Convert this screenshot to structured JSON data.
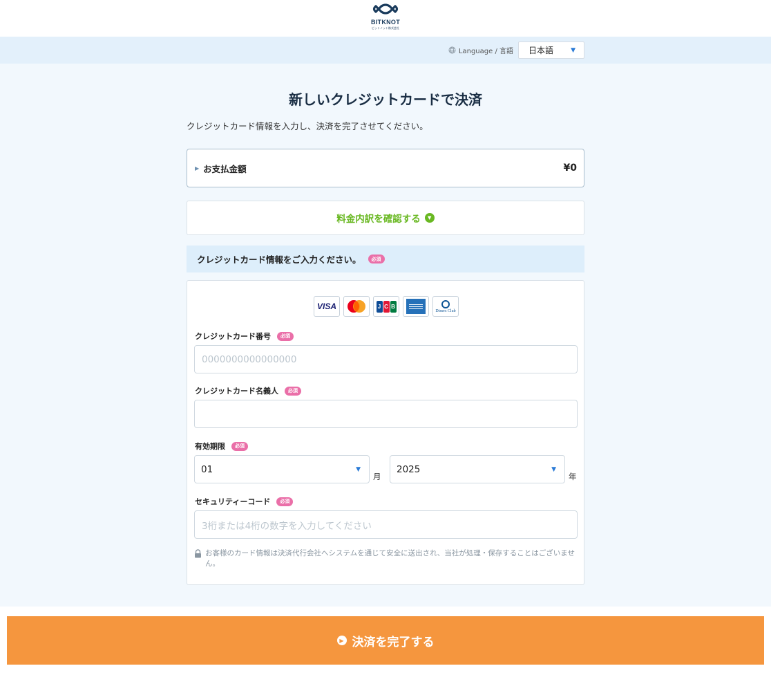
{
  "header": {
    "logo_text": "BITKNOT",
    "logo_subtext": "ビットノット株式会社"
  },
  "langbar": {
    "label": "Language / 言語",
    "selected": "日本語",
    "icon": "globe-icon"
  },
  "page": {
    "title": "新しいクレジットカードで決済",
    "subtitle": "クレジットカード情報を入力し、決済を完了させてください。"
  },
  "amount": {
    "label": "お支払金額",
    "value": "¥0"
  },
  "breakdown": {
    "label": "料金内訳を確認する",
    "icon": "chevron-down-circle-icon"
  },
  "card_section": {
    "title": "クレジットカード情報をご入力ください。",
    "required_badge": "必須"
  },
  "brands": [
    "visa",
    "mastercard",
    "jcb",
    "amex",
    "diners-club"
  ],
  "brand_text": {
    "visa": "VISA",
    "jcb": [
      "J",
      "C",
      "B"
    ],
    "diners": "Diners Club"
  },
  "form": {
    "card_number": {
      "label": "クレジットカード番号",
      "required": "必須",
      "placeholder": "0000000000000000"
    },
    "card_holder": {
      "label": "クレジットカード名義人",
      "required": "必須",
      "placeholder": ""
    },
    "expiry": {
      "label": "有効期限",
      "required": "必須",
      "month": "01",
      "month_unit": "月",
      "year": "2025",
      "year_unit": "年"
    },
    "security_code": {
      "label": "セキュリティーコード",
      "required": "必須",
      "placeholder": "3桁または4桁の数字を入力してください"
    },
    "note": "お客様のカード情報は決済代行会社へシステムを通じて安全に送出され、当社が処理・保存することはございません。"
  },
  "submit": {
    "label": "決済を完了する",
    "icon": "chevron-right-circle-icon"
  },
  "colors": {
    "accent_orange": "#f5963e",
    "accent_green": "#69b822",
    "required_pink": "#ea6fa8",
    "navy": "#1a3b5c",
    "page_bg": "#f2f8fd"
  }
}
